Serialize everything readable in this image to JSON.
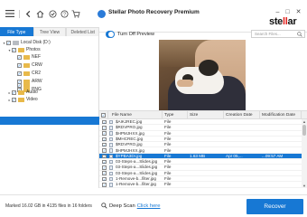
{
  "app": {
    "title": "Stellar Photo Recovery Premium",
    "brand_left": "ste",
    "brand_highlight": "ll",
    "brand_right": "ar"
  },
  "toolbar": {
    "icons": [
      "menu-icon",
      "back-icon",
      "home-icon",
      "check-icon",
      "help-icon",
      "cart-icon"
    ]
  },
  "left_panel": {
    "tabs": [
      {
        "label": "File Type",
        "active": true
      },
      {
        "label": "Tree View",
        "active": false
      },
      {
        "label": "Deleted List",
        "active": false
      }
    ],
    "tree": [
      {
        "label": "Local Disk (D:)"
      },
      {
        "label": "Photos"
      },
      {
        "label": "NEF"
      },
      {
        "label": "CRW"
      },
      {
        "label": "CR2"
      },
      {
        "label": "ARW"
      },
      {
        "label": "PNG"
      },
      {
        "label": "JPEG"
      },
      {
        "label": "Audio"
      },
      {
        "label": "Video"
      }
    ]
  },
  "preview": {
    "toggle_label": "Turn Off Preview",
    "search_placeholder": "Search Files..."
  },
  "grid": {
    "columns": [
      "File Name",
      "Type",
      "Size",
      "Creation Date",
      "Modification Date"
    ],
    "rows": [
      {
        "name": "$AIKJREC.jpg",
        "type": "File",
        "size": "",
        "created": "",
        "modified": ""
      },
      {
        "name": "$RDVPRO.jpg",
        "type": "File",
        "size": "",
        "created": "",
        "modified": ""
      },
      {
        "name": "$HPMJHXX.jpg",
        "type": "File",
        "size": "",
        "created": "",
        "modified": ""
      },
      {
        "name": "$MHCREC.jpg",
        "type": "File",
        "size": "",
        "created": "",
        "modified": ""
      },
      {
        "name": "$RDVPRO.jpg",
        "type": "File",
        "size": "",
        "created": "",
        "modified": ""
      },
      {
        "name": "$HPMJHXX.jpg",
        "type": "File",
        "size": "",
        "created": "",
        "modified": ""
      },
      {
        "name": "$YPBA3DI.jpg",
        "type": "File",
        "size": "1.63 MB",
        "created": "Apr 05,...",
        "modified": "...09:57 AM"
      },
      {
        "name": "03-Steps-a...Slides.jpg",
        "type": "File",
        "size": "",
        "created": "",
        "modified": ""
      },
      {
        "name": "03-Steps-a...Slides.jpg",
        "type": "File",
        "size": "",
        "created": "",
        "modified": ""
      },
      {
        "name": "03-Steps-a...Slides.jpg",
        "type": "File",
        "size": "",
        "created": "",
        "modified": ""
      },
      {
        "name": "1-Remove-b...filter.jpg",
        "type": "File",
        "size": "",
        "created": "",
        "modified": ""
      },
      {
        "name": "1-Remove-b...filter.jpg",
        "type": "File",
        "size": "",
        "created": "",
        "modified": ""
      }
    ]
  },
  "footer": {
    "status": "Marked 16.02 GB in 4135 files in 16 folders",
    "deep_scan_label": "Deep Scan",
    "deep_scan_link": "Click here",
    "recover_label": "Recover"
  },
  "colors": {
    "accent": "#1778d4",
    "brand_red": "#e0231f",
    "folder": "#e8b94a"
  }
}
